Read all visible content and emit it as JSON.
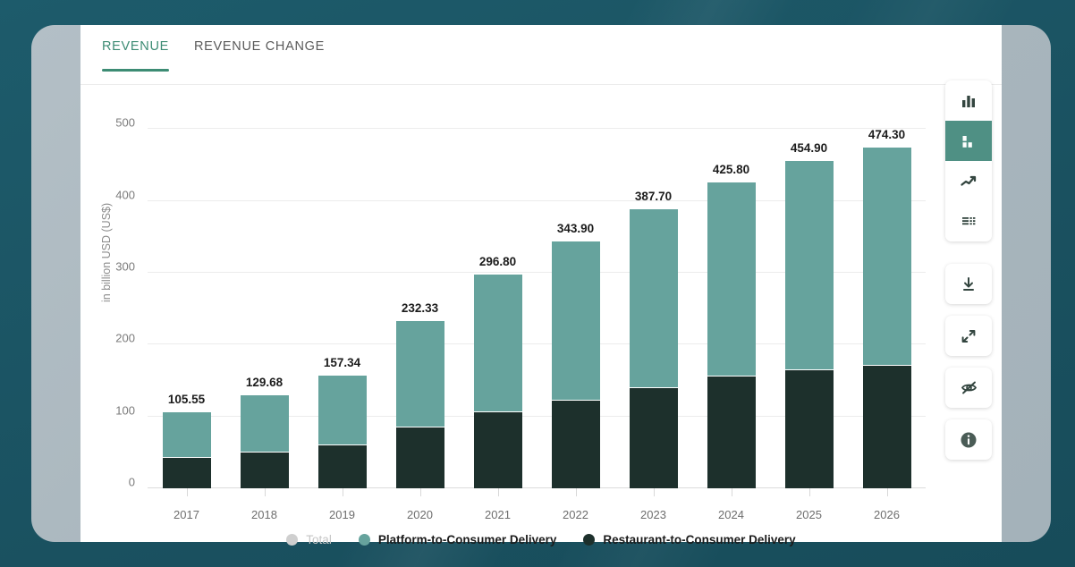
{
  "colors": {
    "background": "#1b5566",
    "panel": "#a9b6bd",
    "card": "#ffffff",
    "accent": "#3d8c74",
    "platform": "#66a39d",
    "restaurant": "#1d302c",
    "disabled": "#c6c6c6",
    "toolbar_active": "#4f9084"
  },
  "tabs": [
    {
      "label": "REVENUE",
      "active": true
    },
    {
      "label": "REVENUE CHANGE",
      "active": false
    }
  ],
  "legend": [
    {
      "label": "Total",
      "color": "#cfcfcf",
      "enabled": false
    },
    {
      "label": "Platform-to-Consumer Delivery",
      "color": "#66a39d",
      "enabled": true
    },
    {
      "label": "Restaurant-to-Consumer Delivery",
      "color": "#1d302c",
      "enabled": true
    }
  ],
  "toolbar": {
    "chart_types": [
      {
        "name": "bar-chart-icon",
        "label": "Bar chart",
        "active": false
      },
      {
        "name": "stacked-bar-chart-icon",
        "label": "Stacked bar chart",
        "active": true
      },
      {
        "name": "line-chart-icon",
        "label": "Line chart",
        "active": false
      },
      {
        "name": "table-icon",
        "label": "Table",
        "active": false
      }
    ],
    "actions": [
      {
        "name": "download-icon",
        "label": "Download"
      },
      {
        "name": "expand-icon",
        "label": "Expand"
      },
      {
        "name": "eye-off-icon",
        "label": "Hide"
      },
      {
        "name": "info-icon",
        "label": "Info"
      }
    ]
  },
  "chart_data": {
    "type": "bar",
    "stacked": true,
    "title": "",
    "xlabel": "",
    "ylabel": "in billion USD (US$)",
    "ylim": [
      0,
      530
    ],
    "yticks": [
      0,
      100,
      200,
      300,
      400,
      500
    ],
    "ytick_labels": [
      "0",
      "100",
      "200",
      "300",
      "400",
      "500"
    ],
    "grid": true,
    "legend_position": "bottom",
    "categories": [
      "2017",
      "2018",
      "2019",
      "2020",
      "2021",
      "2022",
      "2023",
      "2024",
      "2025",
      "2026"
    ],
    "series": [
      {
        "name": "Restaurant-to-Consumer Delivery",
        "color": "#1d302c",
        "values": [
          43.0,
          51.0,
          61.0,
          86.0,
          107.0,
          123.5,
          140.0,
          157.0,
          165.0,
          172.0
        ]
      },
      {
        "name": "Platform-to-Consumer Delivery",
        "color": "#66a39d",
        "values": [
          62.55,
          78.68,
          96.34,
          146.33,
          189.8,
          220.4,
          247.7,
          268.8,
          289.9,
          302.3
        ]
      }
    ],
    "totals": [
      105.55,
      129.68,
      157.34,
      232.33,
      296.8,
      343.9,
      387.7,
      425.8,
      454.9,
      474.3
    ],
    "total_labels": [
      "105.55",
      "129.68",
      "157.34",
      "232.33",
      "296.80",
      "343.90",
      "387.70",
      "425.80",
      "454.90",
      "474.30"
    ]
  }
}
